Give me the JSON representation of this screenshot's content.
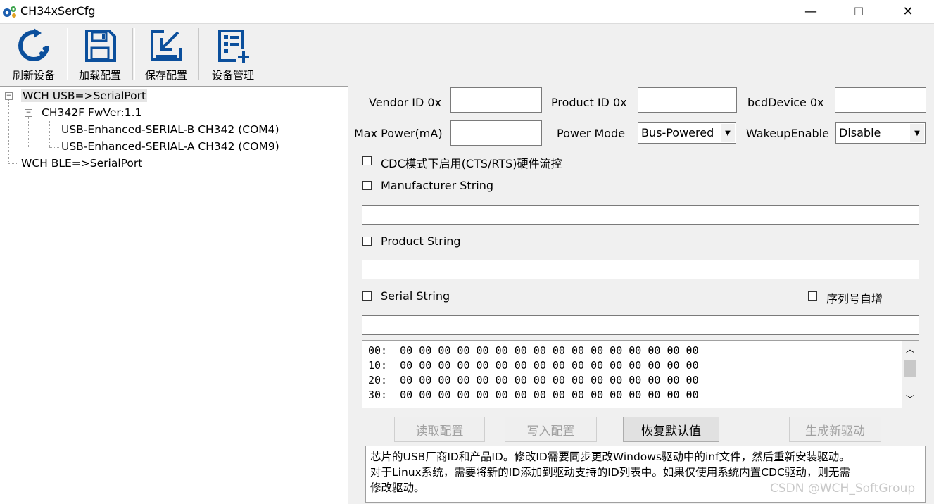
{
  "window": {
    "title": "CH34xSerCfg",
    "minimize": "—",
    "maximize": "☐",
    "close": "✕"
  },
  "toolbar": [
    {
      "label": "刷新设备",
      "icon": "refresh-icon"
    },
    {
      "label": "加载配置",
      "icon": "save-disk-icon"
    },
    {
      "label": "保存配置",
      "icon": "save-arrow-icon"
    },
    {
      "label": "设备管理",
      "icon": "device-manager-icon"
    }
  ],
  "tree": {
    "root_usb": "WCH USB=>SerialPort",
    "chip": "CH342F FwVer:1.1",
    "port_b": "USB-Enhanced-SERIAL-B CH342 (COM4)",
    "port_a": "USB-Enhanced-SERIAL-A CH342 (COM9)",
    "root_ble": "WCH BLE=>SerialPort"
  },
  "form": {
    "vendor_id_label": "Vendor ID 0x",
    "vendor_id_value": "",
    "product_id_label": "Product ID 0x",
    "product_id_value": "",
    "bcd_label": "bcdDevice 0x",
    "bcd_value": "",
    "max_power_label": "Max Power(mA)",
    "max_power_value": "",
    "power_mode_label": "Power Mode",
    "power_mode_value": "Bus-Powered",
    "wakeup_label": "WakeupEnable",
    "wakeup_value": "Disable",
    "cdc_flow_label": "CDC模式下启用(CTS/RTS)硬件流控",
    "manufacturer_label": "Manufacturer String",
    "manufacturer_value": "",
    "product_label": "Product String",
    "product_value": "",
    "serial_label": "Serial String",
    "serial_value": "",
    "serial_auto_label": "序列号自增"
  },
  "hex_dump": [
    "00:  00 00 00 00 00 00 00 00 00 00 00 00 00 00 00 00",
    "10:  00 00 00 00 00 00 00 00 00 00 00 00 00 00 00 00",
    "20:  00 00 00 00 00 00 00 00 00 00 00 00 00 00 00 00",
    "30:  00 00 00 00 00 00 00 00 00 00 00 00 00 00 00 00"
  ],
  "buttons": {
    "read": "读取配置",
    "write": "写入配置",
    "restore": "恢复默认值",
    "generate": "生成新驱动"
  },
  "info_lines": [
    "芯片的USB厂商ID和产品ID。修改ID需要同步更改Windows驱动中的inf文件，然后重新安装驱动。",
    "对于Linux系统，需要将新的ID添加到驱动支持的ID列表中。如果仅使用系统内置CDC驱动，则无需",
    "修改驱动。"
  ],
  "watermark": "CSDN @WCH_SoftGroup",
  "colors": {
    "icon_blue": "#0b4f9c",
    "disabled_text": "#a0a0a0"
  }
}
